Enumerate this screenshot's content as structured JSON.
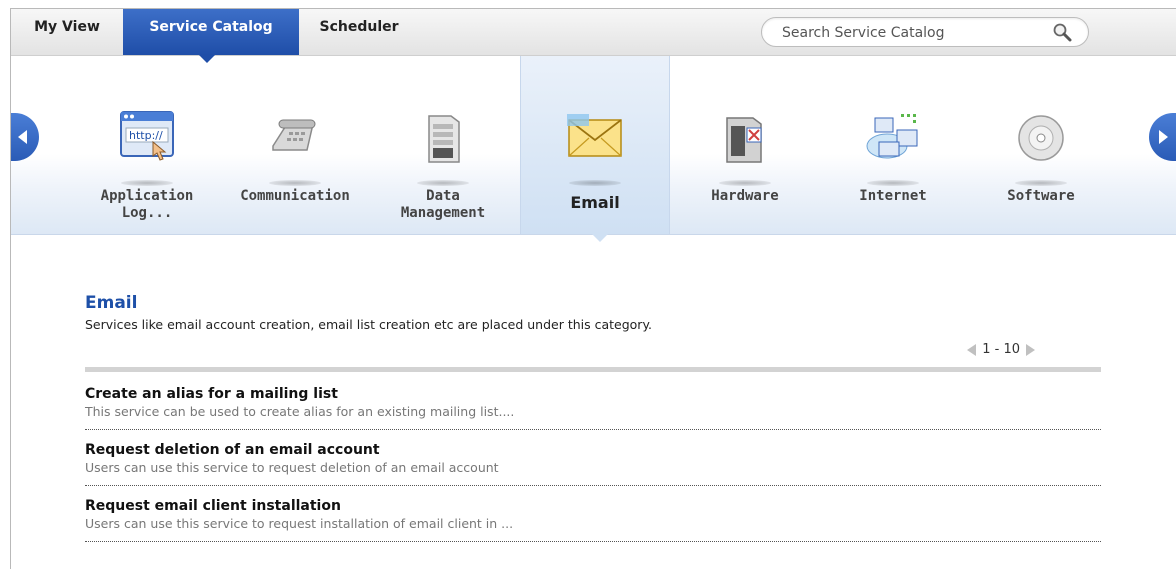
{
  "tabs": [
    {
      "label": "My View"
    },
    {
      "label": "Service Catalog",
      "active": true
    },
    {
      "label": "Scheduler"
    }
  ],
  "search": {
    "placeholder": "Search Service Catalog",
    "icon": "magnifier-icon"
  },
  "categories": [
    {
      "label": "Application\nLog...",
      "icon": "browser-http-icon"
    },
    {
      "label": "Communication",
      "icon": "telephone-icon"
    },
    {
      "label": "Data\nManagement",
      "icon": "server-icon"
    },
    {
      "label": "Email",
      "icon": "envelope-icon",
      "active": true
    },
    {
      "label": "Hardware",
      "icon": "hardware-server-icon"
    },
    {
      "label": "Internet",
      "icon": "network-computers-icon"
    },
    {
      "label": "Software",
      "icon": "cd-disc-icon"
    }
  ],
  "selected": {
    "title": "Email",
    "description": "Services like email account creation, email list creation etc are placed under this category.",
    "pager": "1 - 10"
  },
  "services": [
    {
      "name": "Create an alias for a mailing list",
      "description": "This service can be used to create alias for an existing mailing list...."
    },
    {
      "name": "Request deletion of an email account",
      "description": "Users can use this service to request deletion of an email account"
    },
    {
      "name": "Request email client installation",
      "description": "Users can use this service to request installation of email client in ..."
    }
  ],
  "colors": {
    "accent": "#1f4ea8",
    "title_blue": "#1e50a8",
    "active_category": "#cfe0f3"
  }
}
